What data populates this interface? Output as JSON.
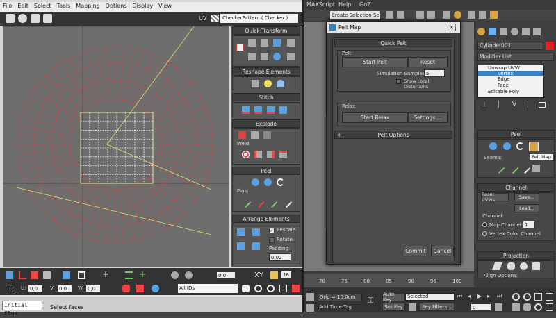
{
  "editor": {
    "menu": [
      "File",
      "Edit",
      "Select",
      "Tools",
      "Mapping",
      "Options",
      "Display",
      "View"
    ],
    "uv_label": "UV",
    "texture_dropdown": "CheckerPattern  ( Checker )",
    "bottom_coords": {
      "u_label": "U:",
      "u_value": "0,0",
      "v_label": "V:",
      "v_value": "0,0",
      "w_label": "W:",
      "w_value": "0,0",
      "id_dropdown": "All IDs",
      "xy_label": "XY",
      "zoom_value": "16",
      "offset_value": "0,0"
    },
    "status_left": "Initial Clus",
    "status_right": "Select faces"
  },
  "side_panels": {
    "quick_transform": "Quick Transform",
    "reshape": "Reshape Elements",
    "stitch": "Stitch",
    "explode": "Explode",
    "weld": "Weld",
    "peel": "Peel",
    "pins": "Pins:",
    "arrange": "Arrange Elements",
    "rescale": "Rescale",
    "rotate": "Rotate",
    "padding_label": "Padding:",
    "padding_value": "0,02"
  },
  "dialog": {
    "title": "Pelt Map",
    "section": "Quick Pelt",
    "pelt_group": "Pelt",
    "start_pelt": "Start Pelt",
    "reset": "Reset",
    "sim_samples_label": "Simulation Samples:",
    "sim_samples_value": "5",
    "show_local": "Show Local Distortions",
    "relax_group": "Relax",
    "start_relax": "Start Relax",
    "settings": "Settings ...",
    "pelt_options": "Pelt Options",
    "commit": "Commit",
    "cancel": "Cancel"
  },
  "max": {
    "menu": [
      "MAXScript",
      "Help",
      "GoZ"
    ],
    "selection_set": "Create Selection Se",
    "object_name": "Cylinder001",
    "modifier_list": "Modifier List",
    "stack": [
      "Unwrap UVW",
      "Vertex",
      "Edge",
      "Face",
      "Editable Poly"
    ],
    "peel_title": "Peel",
    "seams_label": "Seams:",
    "tooltip": "Pelt Map",
    "channel_title": "Channel",
    "reset_uvw": "Reset UVWs",
    "save": "Save...",
    "load": "Load...",
    "channel_label": "Channel:",
    "map_channel": "Map Channel:",
    "map_channel_value": "1",
    "vertex_color_channel": "Vertex Color Channel",
    "projection_title": "Projection",
    "align_options": "Align Options:",
    "timeline_ticks": [
      "70",
      "75",
      "80",
      "85",
      "90",
      "95",
      "100"
    ],
    "grid": "Grid = 10,0cm",
    "add_time_tag": "Add Time Tag",
    "auto_key": "Auto Key",
    "set_key": "Set Key",
    "selected": "Selected",
    "key_filters": "Key Filters...",
    "frame_value": "0"
  }
}
